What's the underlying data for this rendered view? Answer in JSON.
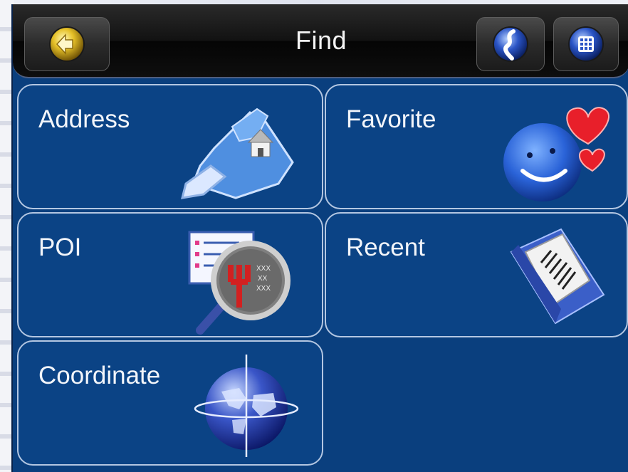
{
  "header": {
    "title": "Find",
    "back_icon": "back-arrow-icon",
    "route_icon": "route-icon",
    "menu_icon": "menu-grid-icon"
  },
  "tiles": [
    {
      "label": "Address",
      "icon": "address-map-icon"
    },
    {
      "label": "Favorite",
      "icon": "favorite-smiley-heart-icon"
    },
    {
      "label": "POI",
      "icon": "poi-magnifier-icon"
    },
    {
      "label": "Recent",
      "icon": "recent-book-icon"
    },
    {
      "label": "Coordinate",
      "icon": "coordinate-globe-icon"
    }
  ],
  "colors": {
    "screen_bg": "#0a3f7e",
    "tile_border": "#b4c7e2",
    "titlebar": "#121212"
  }
}
